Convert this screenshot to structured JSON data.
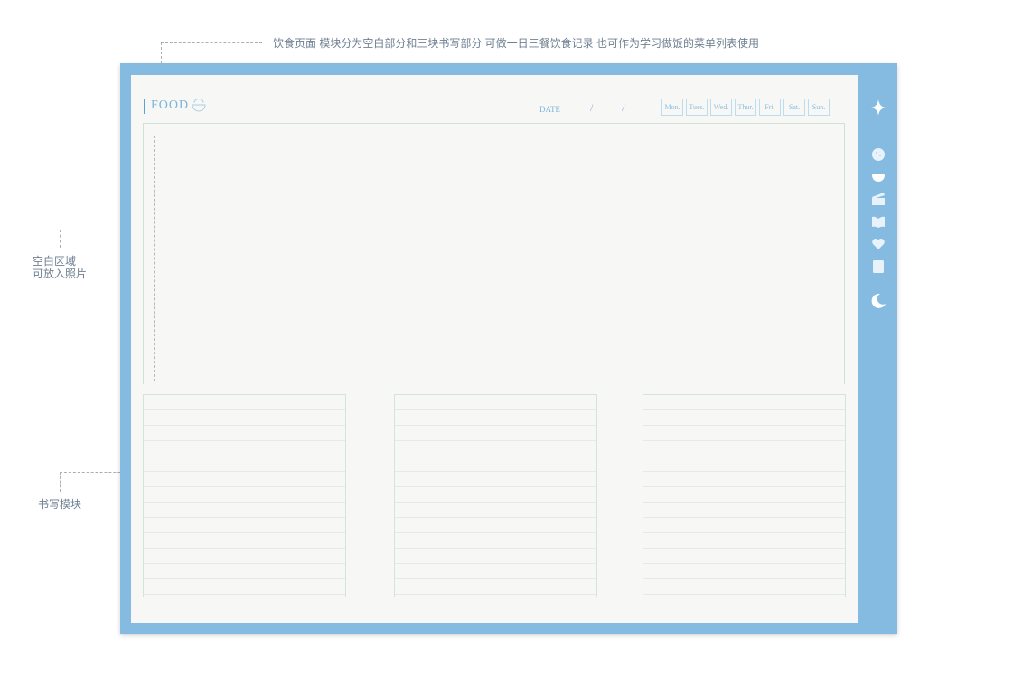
{
  "annotations": {
    "top": "饮食页面 模块分为空白部分和三块书写部分  可做一日三餐饮食记录 也可作为学习做饭的菜单列表使用",
    "blank_line1": "空白区域",
    "blank_line2": "可放入照片",
    "writing": "书写模块"
  },
  "page": {
    "title": "FOOD",
    "date_label": "DATE",
    "date_separators": [
      "/",
      "/"
    ],
    "days": [
      "Mon.",
      "Tues.",
      "Wed.",
      "Thur.",
      "Fri.",
      "Sat.",
      "Sun."
    ]
  },
  "sidebar": {
    "icons": [
      "sparkle-icon",
      "cookie-icon",
      "bowl-icon",
      "clapperboard-icon",
      "book-icon",
      "heart-icon",
      "notebook-icon",
      "moon-icon"
    ]
  },
  "colors": {
    "frame": "#85bbe1",
    "page": "#f7f8f5",
    "accent": "#7fb3da"
  }
}
